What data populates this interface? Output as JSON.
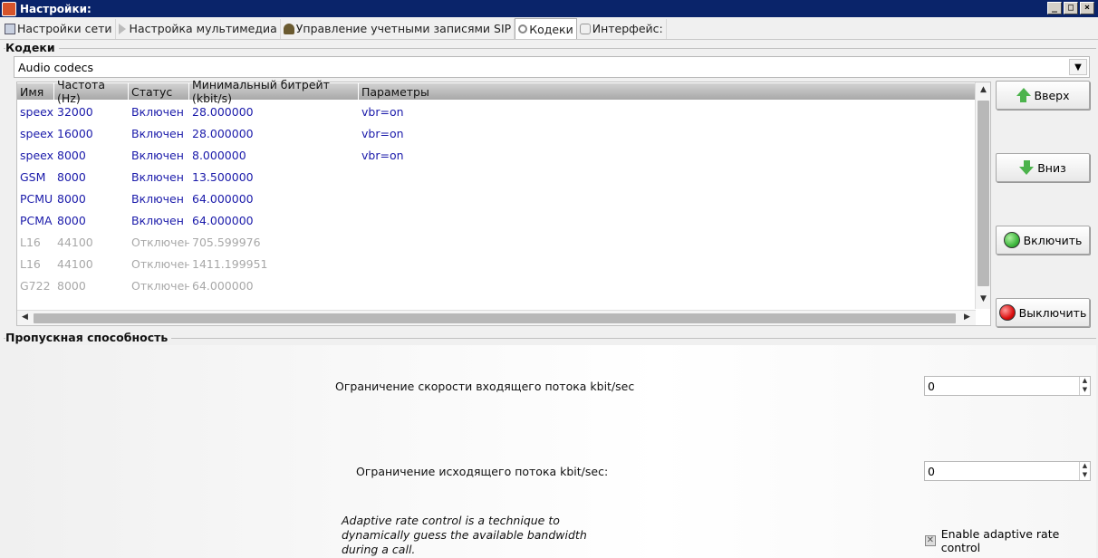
{
  "window": {
    "title": "Настройки:",
    "min": "_",
    "max": "□",
    "close": "×"
  },
  "tabs": [
    {
      "label": "Настройки сети"
    },
    {
      "label": "Настройка мультимедиа"
    },
    {
      "label": "Управление учетными записями SIP"
    },
    {
      "label": "Кодеки"
    },
    {
      "label": "Интерфейс:"
    }
  ],
  "codecs": {
    "group_title": "Кодеки",
    "combo_value": "Audio codecs",
    "columns": [
      "Имя",
      "Частота (Hz)",
      "Статус",
      "Минимальный битрейт (kbit/s)",
      "Параметры"
    ],
    "rows": [
      {
        "name": "speex",
        "rate": "32000",
        "status": "Включен",
        "bitrate": "28.000000",
        "params": "vbr=on",
        "enabled": true
      },
      {
        "name": "speex",
        "rate": "16000",
        "status": "Включен",
        "bitrate": "28.000000",
        "params": "vbr=on",
        "enabled": true
      },
      {
        "name": "speex",
        "rate": "8000",
        "status": "Включен",
        "bitrate": "8.000000",
        "params": "vbr=on",
        "enabled": true
      },
      {
        "name": "GSM",
        "rate": "8000",
        "status": "Включен",
        "bitrate": "13.500000",
        "params": "",
        "enabled": true
      },
      {
        "name": "PCMU",
        "rate": "8000",
        "status": "Включен",
        "bitrate": "64.000000",
        "params": "",
        "enabled": true
      },
      {
        "name": "PCMA",
        "rate": "8000",
        "status": "Включен",
        "bitrate": "64.000000",
        "params": "",
        "enabled": true
      },
      {
        "name": "L16",
        "rate": "44100",
        "status": "Отключен",
        "bitrate": "705.599976",
        "params": "",
        "enabled": false
      },
      {
        "name": "L16",
        "rate": "44100",
        "status": "Отключен",
        "bitrate": "1411.199951",
        "params": "",
        "enabled": false
      },
      {
        "name": "G722",
        "rate": "8000",
        "status": "Отключен",
        "bitrate": "64.000000",
        "params": "",
        "enabled": false
      }
    ],
    "buttons": {
      "up": "Вверх",
      "down": "Вниз",
      "enable": "Включить",
      "disable": "Выключить"
    }
  },
  "bandwidth": {
    "group_title": "Пропускная способность",
    "incoming_label": "Ограничение скорости входящего потока kbit/sec",
    "incoming_value": "0",
    "outgoing_label": "Ограничение исходящего потока kbit/sec:",
    "outgoing_value": "0",
    "adaptive_note": "Adaptive rate control is a technique to dynamically guess the available bandwidth during a call.",
    "adaptive_checkbox_label": "Enable adaptive rate control",
    "adaptive_checked": true
  },
  "colors": {
    "titlebar": "#0a246a",
    "enabled_text": "#1a1aaa",
    "disabled_text": "#a8a8a8",
    "enable_dot": "#3fb83f",
    "disable_dot": "#dd1111"
  }
}
